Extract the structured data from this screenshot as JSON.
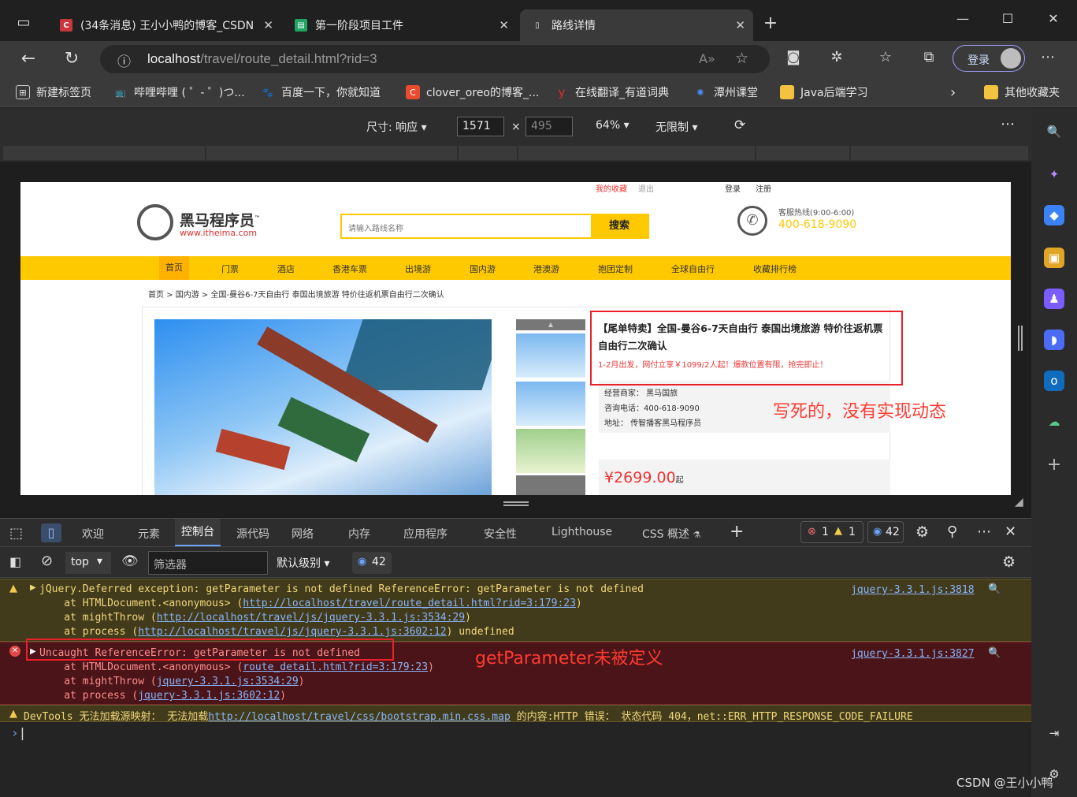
{
  "browser": {
    "tabs": [
      {
        "title": "(34条消息) 王小小鸭的博客_CSDN",
        "favicon": "C"
      },
      {
        "title": "第一阶段项目工件",
        "favicon": "▤"
      },
      {
        "title": "路线详情",
        "favicon": "▯"
      }
    ],
    "url_host": "localhost",
    "url_path": "/travel/route_detail.html?rid=3",
    "login_label": "登录",
    "bookmarks": [
      "新建标签页",
      "哔哩哔哩 ( ゜- ゜)つ...",
      "百度一下，你就知道",
      "clover_oreo的博客_...",
      "在线翻译_有道词典",
      "潭州课堂",
      "Java后端学习",
      "其他收藏夹"
    ]
  },
  "device_toolbar": {
    "size_label": "尺寸: 响应",
    "width": "1571",
    "x": "×",
    "height": "495",
    "zoom": "64%",
    "throttle": "无限制"
  },
  "page": {
    "topline_left": [
      "我的收藏",
      "退出"
    ],
    "topline_right": [
      "登录",
      "注册"
    ],
    "logo_name": "黑马程序员",
    "logo_tm": "™",
    "logo_web": "www.itheima.com",
    "search_placeholder": "请输入路线名称",
    "search_button": "搜索",
    "hotline_label": "客服热线(9:00-6:00)",
    "hotline_number": "400-618-9090",
    "nav": [
      "首页",
      "门票",
      "酒店",
      "香港车票",
      "出境游",
      "国内游",
      "港澳游",
      "抱团定制",
      "全球自由行",
      "收藏排行榜"
    ],
    "breadcrumb": "首页 > 国内游 > 全国-曼谷6-7天自由行 泰国出境旅游 特价往返机票自由行二次确认",
    "route_title": "【尾单特卖】全国-曼谷6-7天自由行 泰国出境旅游 特价往返机票自由行二次确认",
    "route_subtitle": "1-2月出发，网付立享￥1099/2人起！爆款位置有限，抢完即止！",
    "seller": "经营商家： 黑马国旅",
    "phone": "咨询电话：400-618-9090",
    "address": "地址： 传智播客黑马程序员",
    "price": "¥2699.00",
    "price_suffix": "起"
  },
  "annotations": {
    "hardcoded_note": "写死的，没有实现动态",
    "undefined_note": "getParameter未被定义"
  },
  "devtools": {
    "tabs": [
      "欢迎",
      "元素",
      "控制台",
      "源代码",
      "网络",
      "内存",
      "应用程序",
      "安全性",
      "Lighthouse",
      "CSS 概述"
    ],
    "error_count": "1",
    "warn_count": "1",
    "msg_count": "42",
    "context": "top",
    "filter_placeholder": "筛选器",
    "level": "默认级别",
    "issues": "42"
  },
  "console": {
    "warn1": {
      "head": "jQuery.Deferred exception: getParameter is not defined ReferenceError: getParameter is not defined",
      "l1_pre": "    at HTMLDocument.<anonymous> (",
      "l1_link": "http://localhost/travel/route_detail.html?rid=3:179:23",
      "l2_pre": "    at mightThrow (",
      "l2_link": "http://localhost/travel/js/jquery-3.3.1.js:3534:29",
      "l3_pre": "    at process (",
      "l3_link": "http://localhost/travel/js/jquery-3.3.1.js:3602:12",
      "l3_post": ") undefined",
      "close": ")",
      "src": "jquery-3.3.1.js:3818"
    },
    "error1": {
      "head": "Uncaught ReferenceError: getParameter is not defined",
      "l1_pre": "    at HTMLDocument.<anonymous> (",
      "l1_link": "route_detail.html?rid=3:179:23",
      "l2_pre": "    at mightThrow (",
      "l2_link": "jquery-3.3.1.js:3534:29",
      "l3_pre": "    at process (",
      "l3_link": "jquery-3.3.1.js:3602:12",
      "close": ")",
      "src": "jquery-3.3.1.js:3827"
    },
    "warn2": {
      "pre": "DevTools 无法加载源映射： 无法加载",
      "link": "http://localhost/travel/css/bootstrap.min.css.map",
      "post": " 的内容:HTTP 错误： 状态代码 404，net::ERR_HTTP_RESPONSE_CODE_FAILURE"
    },
    "prompt": "›"
  },
  "watermark": "CSDN @王小小鸭"
}
